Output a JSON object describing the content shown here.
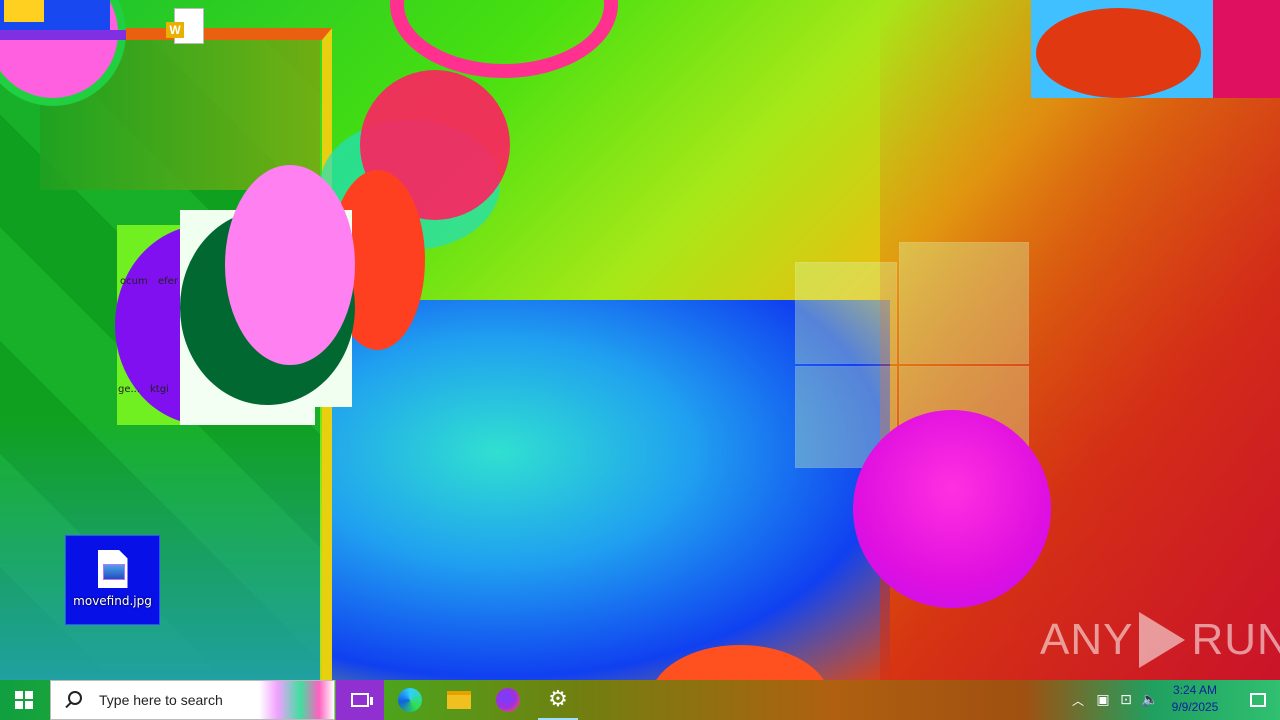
{
  "desktop": {
    "icons": [
      {
        "label": "movefind.jpg",
        "type": "image-file-icon",
        "selected": true
      }
    ],
    "fragments": [
      "ocum",
      "efer",
      "ge...",
      "ktgi"
    ]
  },
  "watermark": {
    "left": "ANY",
    "right": "RUN"
  },
  "taskbar": {
    "search_placeholder": "Type here to search",
    "pinned": [
      {
        "name": "task-view",
        "icon": "task-view-icon"
      },
      {
        "name": "edge",
        "icon": "edge-icon"
      },
      {
        "name": "file-explorer",
        "icon": "folder-icon"
      },
      {
        "name": "firefox",
        "icon": "firefox-icon"
      },
      {
        "name": "settings",
        "icon": "gear-icon",
        "active": true
      }
    ],
    "tray": {
      "time": "3:24 AM",
      "date": "9/9/2025"
    }
  },
  "colors": {
    "selection": "#0810e8",
    "clock_text": "#1020a0"
  }
}
